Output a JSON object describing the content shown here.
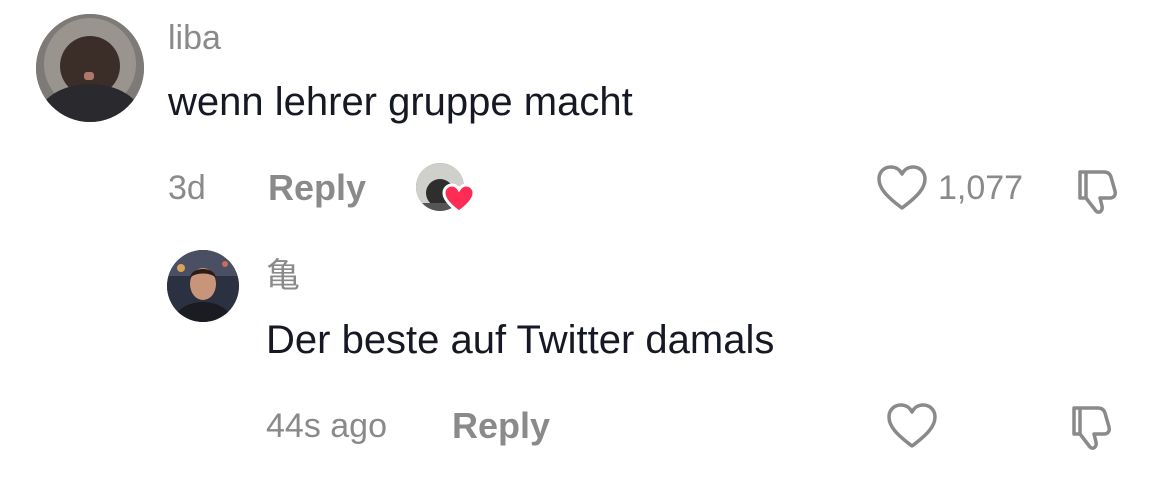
{
  "comments": [
    {
      "username": "liba",
      "text": "wenn lehrer gruppe macht",
      "time": "3d",
      "reply_label": "Reply",
      "likes": "1,077",
      "liked_by_creator": true
    },
    {
      "username": "亀",
      "text": "Der beste auf Twitter damals",
      "time": "44s ago",
      "reply_label": "Reply",
      "likes": ""
    }
  ],
  "colors": {
    "primary_text": "#161823",
    "secondary_text": "#8a8a8a",
    "heart_badge": "#fe2c55",
    "icon_stroke": "#8a8a8a"
  },
  "icons": [
    "heart-outline-icon",
    "dislike-icon",
    "heart-badge-icon"
  ]
}
